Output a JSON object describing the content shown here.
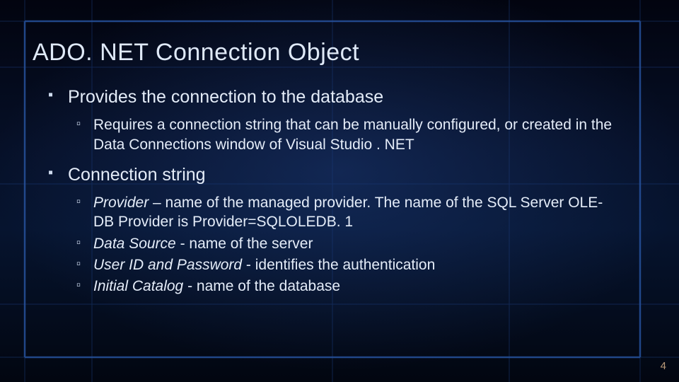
{
  "slide": {
    "title": "ADO. NET Connection Object",
    "page_number": "4",
    "bullets": [
      {
        "text": "Provides the connection to the database",
        "children": [
          {
            "text": "Requires a connection string that can be manually configured, or created in the Data Connections window of Visual Studio . NET"
          }
        ]
      },
      {
        "text": "Connection string",
        "children": [
          {
            "term": "Provider",
            "rest": " – name of the managed  provider. The name of the SQL Server OLE-DB Provider is Provider=SQLOLEDB. 1"
          },
          {
            "term": "Data Source",
            "rest": " - name of the server"
          },
          {
            "term": "User ID and Password",
            "rest": " - identifies the authentication"
          },
          {
            "term": "Initial Catalog",
            "rest": " - name of the database"
          }
        ]
      }
    ]
  }
}
